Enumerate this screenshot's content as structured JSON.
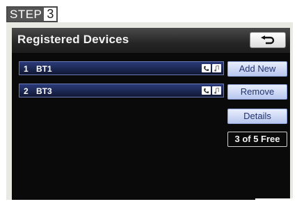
{
  "step": {
    "label": "STEP",
    "number": "3"
  },
  "header": {
    "title": "Registered Devices"
  },
  "devices": [
    {
      "index": "1",
      "name": "BT1"
    },
    {
      "index": "2",
      "name": "BT3"
    }
  ],
  "buttons": {
    "add_new": "Add New",
    "remove": "Remove",
    "details": "Details"
  },
  "status": {
    "free_slots": "3 of 5 Free"
  },
  "icons": {
    "back": "back-arrow-icon",
    "phone": "phone-icon",
    "music": "music-note-icon"
  },
  "colors": {
    "title_bar": "#262626",
    "row": "#1f2a5c",
    "button": "#c4d0f2"
  }
}
